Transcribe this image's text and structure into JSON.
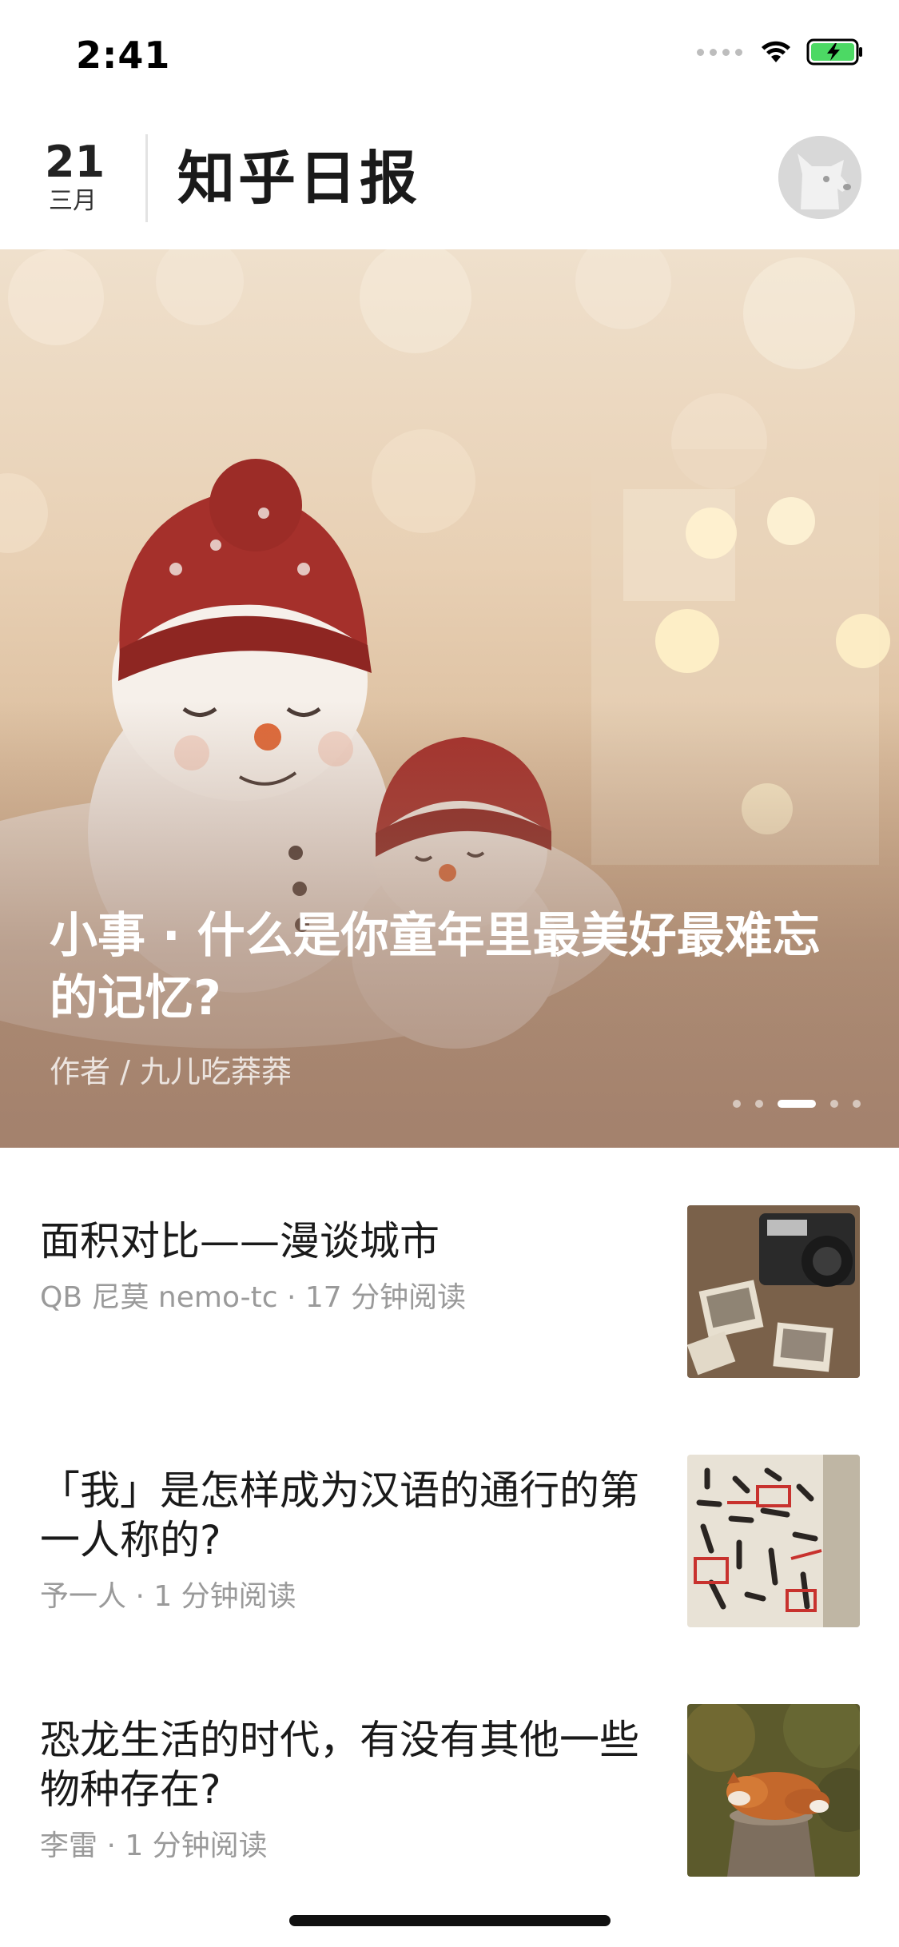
{
  "status_bar": {
    "time": "2:41",
    "icons": [
      "signal-dots-icon",
      "wifi-icon",
      "battery-charging-icon"
    ],
    "battery_color": "#4cd964"
  },
  "header": {
    "day": "21",
    "month": "三月",
    "title": "知乎日报",
    "avatar_icon": "dog-avatar-icon"
  },
  "hero": {
    "title": "小事 · 什么是你童年里最美好最难忘的记忆?",
    "author": "作者 / 九儿吃莽莽",
    "pager_count": 5,
    "pager_active": 3
  },
  "stories": [
    {
      "title": "面积对比——漫谈城市",
      "meta": "QB 尼莫 nemo-tc · 17 分钟阅读",
      "thumb": "vintage-camera-photos-thumbnail"
    },
    {
      "title": "「我」是怎样成为汉语的通行的第一人称的?",
      "meta": "予一人 · 1 分钟阅读",
      "thumb": "calligraphy-manuscript-thumbnail"
    },
    {
      "title": "恐龙生活的时代，有没有其他一些物种存在?",
      "meta": "李雷 · 1 分钟阅读",
      "thumb": "sleeping-fox-thumbnail"
    }
  ]
}
